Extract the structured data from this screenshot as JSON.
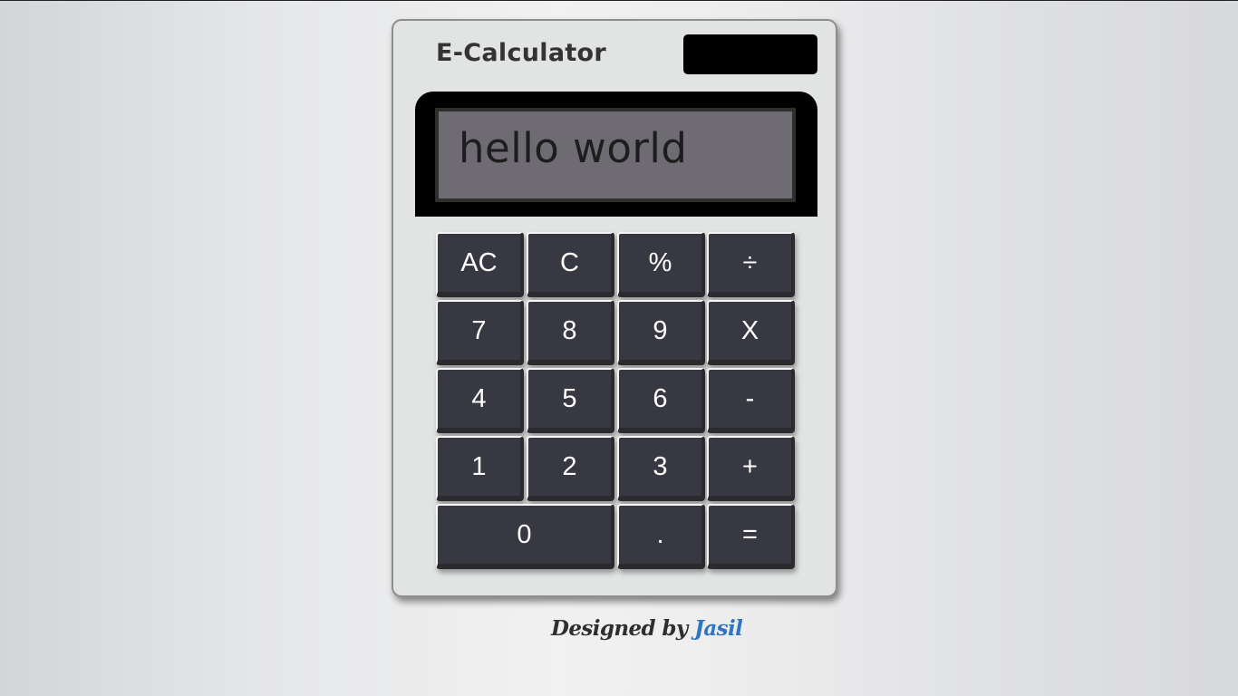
{
  "app": {
    "brand": "E-Calculator"
  },
  "display": {
    "text": "hello world"
  },
  "keys": [
    {
      "label": "AC",
      "name": "key-all-clear"
    },
    {
      "label": "C",
      "name": "key-clear"
    },
    {
      "label": "%",
      "name": "key-percent"
    },
    {
      "label": "÷",
      "name": "key-divide"
    },
    {
      "label": "7",
      "name": "key-7"
    },
    {
      "label": "8",
      "name": "key-8"
    },
    {
      "label": "9",
      "name": "key-9"
    },
    {
      "label": "X",
      "name": "key-multiply"
    },
    {
      "label": "4",
      "name": "key-4"
    },
    {
      "label": "5",
      "name": "key-5"
    },
    {
      "label": "6",
      "name": "key-6"
    },
    {
      "label": "-",
      "name": "key-subtract"
    },
    {
      "label": "1",
      "name": "key-1"
    },
    {
      "label": "2",
      "name": "key-2"
    },
    {
      "label": "3",
      "name": "key-3"
    },
    {
      "label": "+",
      "name": "key-add"
    },
    {
      "label": "0",
      "name": "key-0"
    },
    {
      "label": ".",
      "name": "key-decimal"
    },
    {
      "label": "=",
      "name": "key-equals"
    }
  ],
  "footer": {
    "prefix": "Designed by",
    "author": "Jasil"
  },
  "colors": {
    "key_face": "#373841",
    "display_screen": "#6e6b73",
    "author_link": "#2f75c2"
  }
}
